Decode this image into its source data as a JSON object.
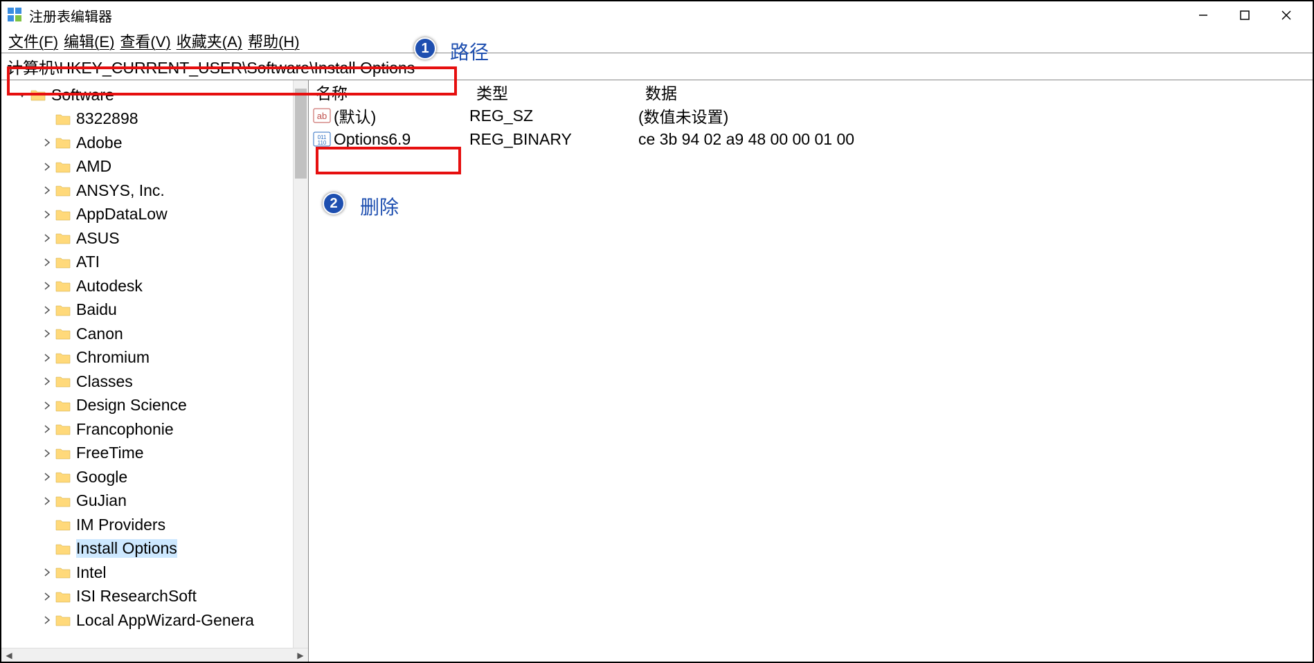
{
  "window": {
    "title": "注册表编辑器"
  },
  "menu": {
    "file": "文件(F)",
    "edit": "编辑(E)",
    "view": "查看(V)",
    "favorites": "收藏夹(A)",
    "help": "帮助(H)"
  },
  "address_bar": {
    "path": "计算机\\HKEY_CURRENT_USER\\Software\\Install Options"
  },
  "annotations": {
    "badge1": "1",
    "label1": "路径",
    "badge2": "2",
    "label2": "删除"
  },
  "tree": {
    "root": {
      "label": "Software",
      "expanded": true
    },
    "children": [
      {
        "label": "8322898",
        "has_children": false
      },
      {
        "label": "Adobe",
        "has_children": true
      },
      {
        "label": "AMD",
        "has_children": true
      },
      {
        "label": "ANSYS, Inc.",
        "has_children": true
      },
      {
        "label": "AppDataLow",
        "has_children": true
      },
      {
        "label": "ASUS",
        "has_children": true
      },
      {
        "label": "ATI",
        "has_children": true
      },
      {
        "label": "Autodesk",
        "has_children": true
      },
      {
        "label": "Baidu",
        "has_children": true
      },
      {
        "label": "Canon",
        "has_children": true
      },
      {
        "label": "Chromium",
        "has_children": true
      },
      {
        "label": "Classes",
        "has_children": true
      },
      {
        "label": "Design Science",
        "has_children": true
      },
      {
        "label": "Francophonie",
        "has_children": true
      },
      {
        "label": "FreeTime",
        "has_children": true
      },
      {
        "label": "Google",
        "has_children": true
      },
      {
        "label": "GuJian",
        "has_children": true
      },
      {
        "label": "IM Providers",
        "has_children": false
      },
      {
        "label": "Install Options",
        "has_children": false,
        "selected": true
      },
      {
        "label": "Intel",
        "has_children": true
      },
      {
        "label": "ISI ResearchSoft",
        "has_children": true
      },
      {
        "label": "Local AppWizard-Genera",
        "has_children": true
      }
    ]
  },
  "list": {
    "headers": {
      "name": "名称",
      "type": "类型",
      "data": "数据"
    },
    "rows": [
      {
        "icon": "string",
        "name": "(默认)",
        "type": "REG_SZ",
        "data": "(数值未设置)"
      },
      {
        "icon": "binary",
        "name": "Options6.9",
        "type": "REG_BINARY",
        "data": "ce 3b 94 02 a9 48 00 00 01 00"
      }
    ]
  }
}
